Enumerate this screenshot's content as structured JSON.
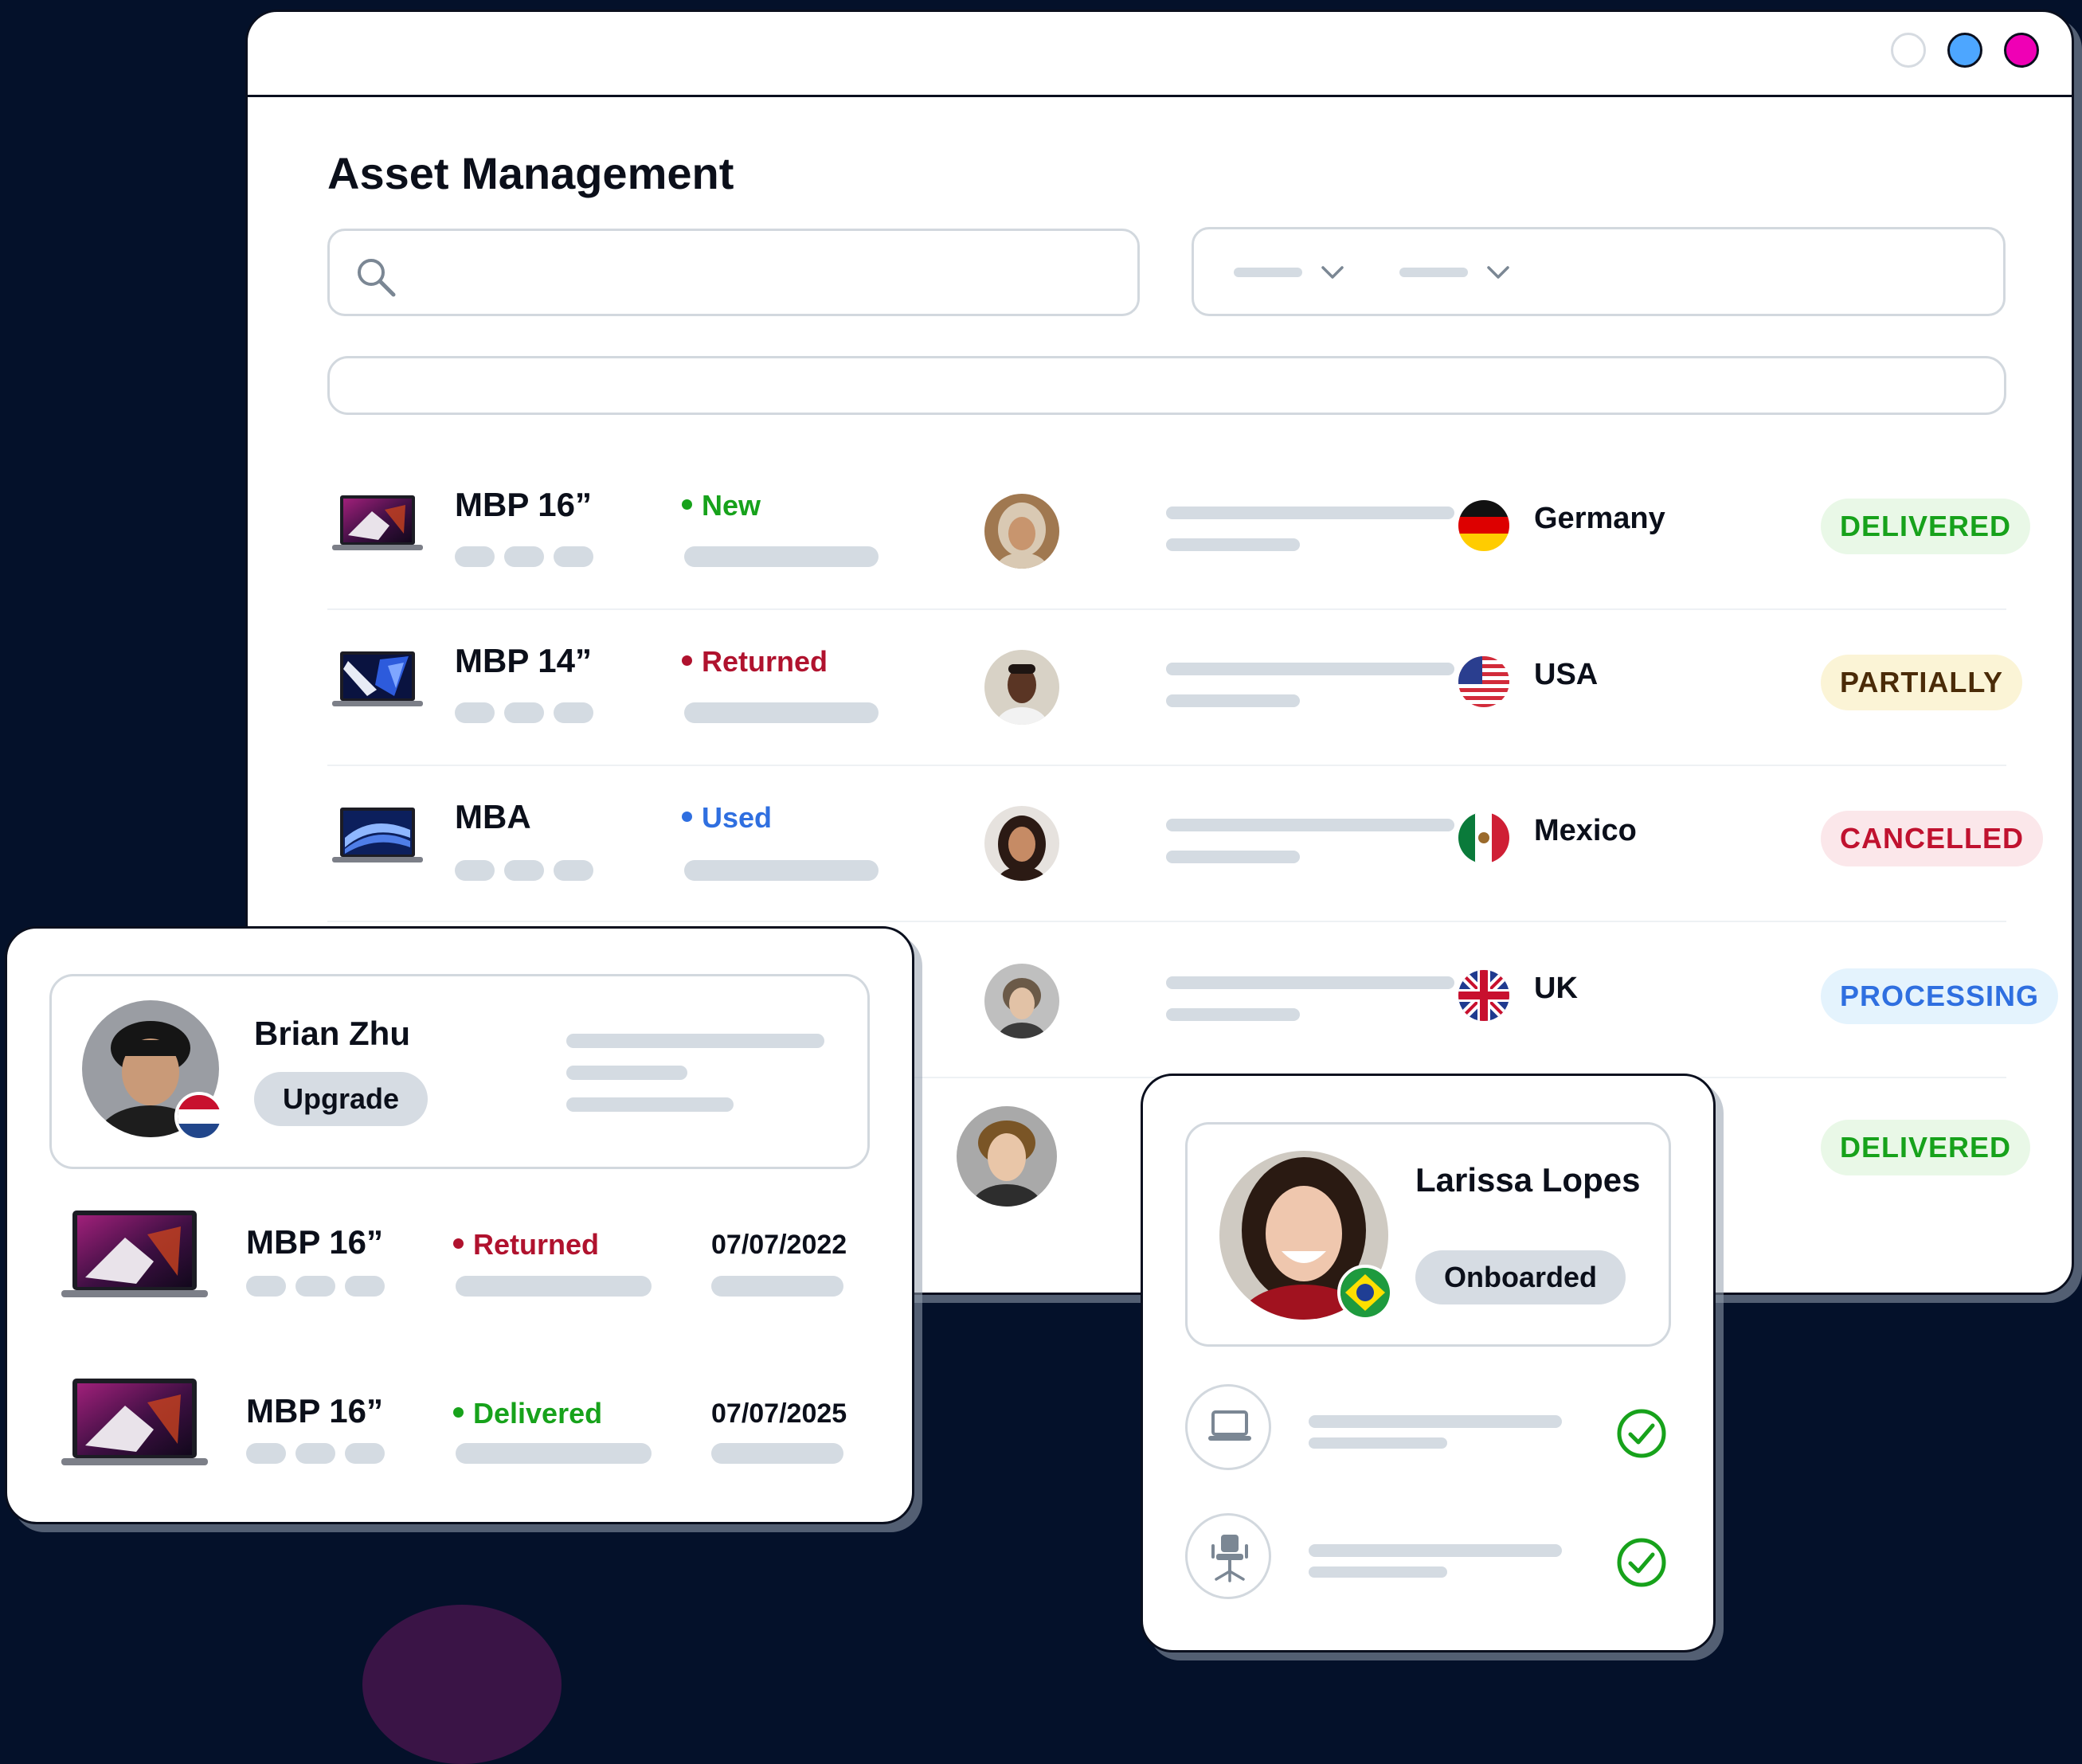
{
  "app": {
    "title": "Asset Management",
    "window_controls": [
      "light-dot",
      "blue-dot",
      "pink-dot"
    ]
  },
  "colors": {
    "background": "#04112a",
    "new": "#17a21b",
    "returned": "#b0122e",
    "used": "#2f6fe0",
    "delivered_text": "#17a21b",
    "delivered_bg": "#e9f8e7",
    "partially_text": "#4a2b08",
    "partially_bg": "#fbf4d6",
    "cancelled_text": "#c0122f",
    "cancelled_bg": "#fbe7ea",
    "processing_text": "#2f6fe0",
    "processing_bg": "#e4f3fd"
  },
  "assets": [
    {
      "model": "MBP 16”",
      "condition": "New",
      "country": "Germany",
      "status": "DELIVERED"
    },
    {
      "model": "MBP 14”",
      "condition": "Returned",
      "country": "USA",
      "status": "PARTIALLY"
    },
    {
      "model": "MBA",
      "condition": "Used",
      "country": "Mexico",
      "status": "CANCELLED"
    },
    {
      "country": "UK",
      "status": "PROCESSING"
    },
    {
      "status": "DELIVERED"
    }
  ],
  "brian_card": {
    "name": "Brian Zhu",
    "action": "Upgrade",
    "devices": [
      {
        "model": "MBP 16”",
        "condition": "Returned",
        "date": "07/07/2022"
      },
      {
        "model": "MBP 16”",
        "condition": "Delivered",
        "date": "07/07/2025"
      }
    ]
  },
  "larissa_card": {
    "name": "Larissa Lopes",
    "action": "Onboarded",
    "items": [
      {
        "icon": "laptop-icon",
        "done": true
      },
      {
        "icon": "office-chair-icon",
        "done": true
      }
    ]
  }
}
